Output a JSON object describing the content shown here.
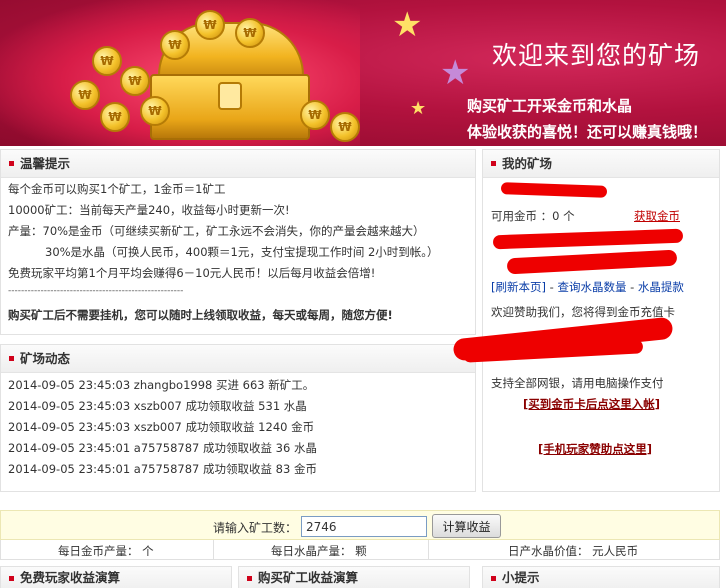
{
  "banner": {
    "title": "欢迎来到您的矿场",
    "subtitle1": "购买矿工开采金币和水晶",
    "subtitle2": "体验收获的喜悦！还可以赚真钱哦！"
  },
  "tips": {
    "heading": "温馨提示",
    "lines": [
      "每个金币可以购买1个矿工，1金币＝1矿工",
      "10000矿工：当前每天产量240，收益每小时更新一次!",
      "产量：70%是金币（可继续买新矿工，矿工永远不会消失，你的产量会越来越大）",
      "30%是水晶（可换人民币，400颗＝1元，支付宝提现工作时间 2小时到帐。）",
      "免费玩家平均第1个月平均会赚得6－10元人民币！以后每月收益会倍增!"
    ],
    "separator": "------------------------------------------------------",
    "notice": "购买矿工后不需要挂机，您可以随时上线领取收益，每天或每周，随您方便!"
  },
  "activity": {
    "heading": "矿场动态",
    "items": [
      "2014-09-05 23:45:03 zhangbo1998 买进 663 新矿工。",
      "2014-09-05 23:45:03 xszb007 成功领取收益 531 水晶",
      "2014-09-05 23:45:03 xszb007 成功领取收益 1240 金币",
      "2014-09-05 23:45:01 a75758787 成功领取收益 36 水晶",
      "2014-09-05 23:45:01 a75758787 成功领取收益 83 金币"
    ]
  },
  "mine": {
    "heading": "我的矿场",
    "coins_label": "可用金币 ：0 个",
    "get_coins_link": "获取金币",
    "refresh_link": "[刷新本页]",
    "sep1": "-",
    "query_crystal_link": "查询水晶数量",
    "sep2": "-",
    "crystal_withdraw_link": "水晶提款",
    "sponsor_text": "欢迎赞助我们，您将得到金币充值卡",
    "payment_text": "支持全部网银，请用电脑操作支付",
    "buy_card_link": "[买到金币卡后点这里入帐]",
    "mobile_sponsor_link": "[手机玩家赞助点这里]"
  },
  "calculator": {
    "label": "请输入矿工数：",
    "input_value": "2746",
    "button_label": "计算收益",
    "daily_coins": "每日金币产量： 个",
    "daily_crystals": "每日水晶产量： 颗",
    "crystal_value": "日产水晶价值： 元人民币"
  },
  "bottom": {
    "free_title": "免费玩家收益演算",
    "buy_title": "购买矿工收益演算",
    "tips_title": "小提示"
  },
  "colors": {
    "banner_bg": "#b2123e",
    "accent_red": "#d0021b",
    "link_blue": "#0b3ea8",
    "link_red": "#c00000"
  }
}
